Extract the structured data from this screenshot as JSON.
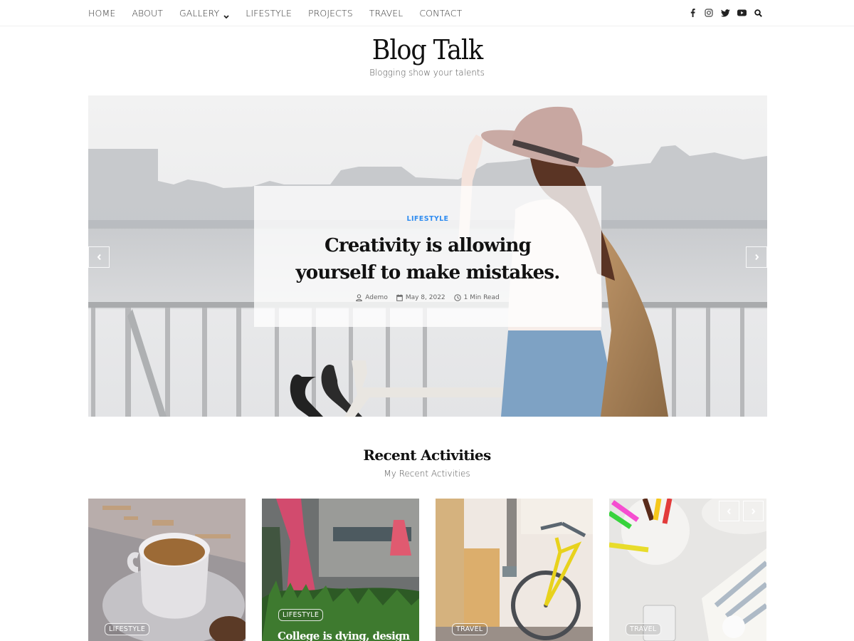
{
  "nav": {
    "items": [
      {
        "label": "HOME"
      },
      {
        "label": "ABOUT"
      },
      {
        "label": "GALLERY",
        "has_dropdown": true
      },
      {
        "label": "LIFESTYLE"
      },
      {
        "label": "PROJECTS"
      },
      {
        "label": "TRAVEL"
      },
      {
        "label": "CONTACT"
      }
    ],
    "social_icons": [
      "facebook-icon",
      "instagram-icon",
      "twitter-icon",
      "youtube-icon",
      "search-icon"
    ]
  },
  "brand": {
    "title": "Blog Talk",
    "tagline": "Blogging show your talents"
  },
  "hero": {
    "category": "LIFESTYLE",
    "title": "Creativity is allowing yourself to make mistakes.",
    "author": "Ademo",
    "date": "May 8, 2022",
    "read_time": "1 Min Read",
    "prev_icon": "chevron-left-icon",
    "next_icon": "chevron-right-icon"
  },
  "recent": {
    "title": "Recent Activities",
    "subtitle": "My Recent Activities",
    "cards": [
      {
        "category": "LIFESTYLE",
        "title": ""
      },
      {
        "category": "LIFESTYLE",
        "title": "College is dying, design"
      },
      {
        "category": "TRAVEL",
        "title": ""
      },
      {
        "category": "TRAVEL",
        "title": ""
      }
    ]
  },
  "colors": {
    "accent": "#2f8cf0",
    "text_dark": "#111111",
    "text_muted": "#555555"
  }
}
